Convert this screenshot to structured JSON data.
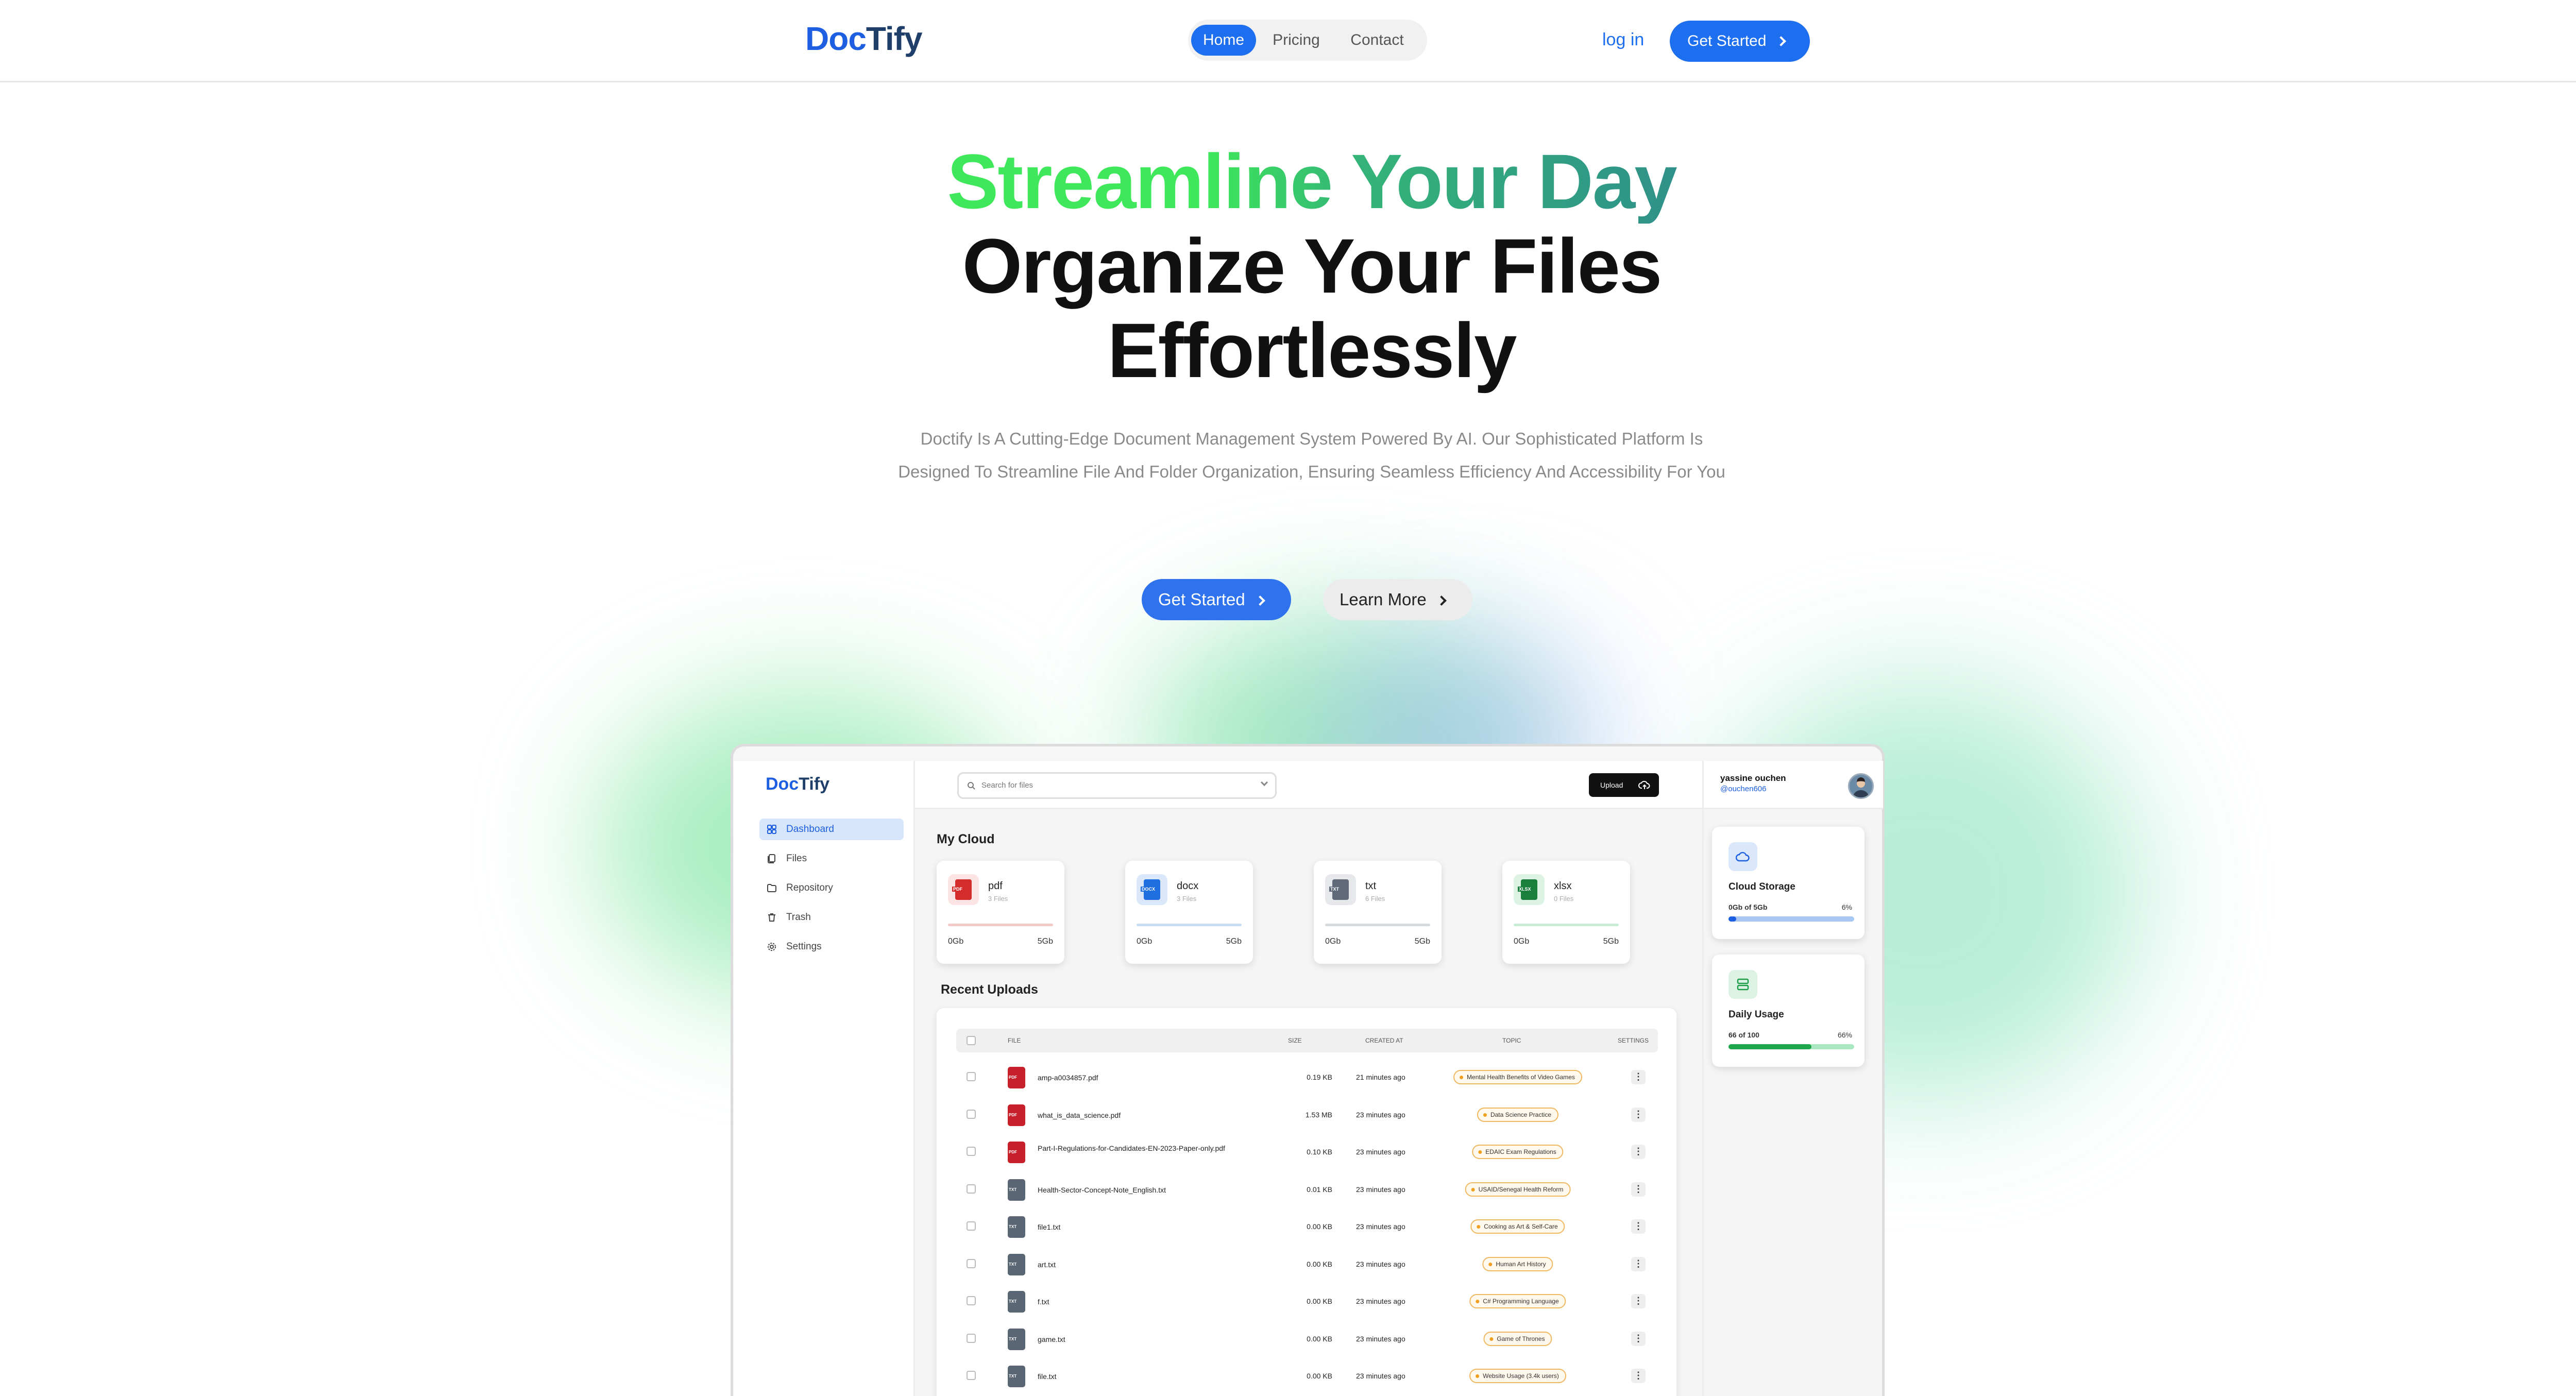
{
  "nav": {
    "logo_a": "Doc",
    "logo_b": "Tify",
    "home": "Home",
    "pricing": "Pricing",
    "contact": "Contact",
    "login": "log in",
    "get_started": "Get Started"
  },
  "hero": {
    "line1": "Streamline Your Day",
    "line2": "Organize Your Files",
    "line3": "Effortlessly",
    "subtitle": "Doctify Is A Cutting-Edge Document Management System Powered By AI. Our Sophisticated Platform Is Designed To Streamline File And Folder Organization, Ensuring Seamless Efficiency And Accessibility For You",
    "cta_primary": "Get Started",
    "cta_secondary": "Learn More"
  },
  "app": {
    "logo_a": "Doc",
    "logo_b": "Tify",
    "sidebar": [
      "Dashboard",
      "Files",
      "Repository",
      "Trash",
      "Settings"
    ],
    "search_placeholder": "Search for files",
    "upload_label": "Upload",
    "my_cloud": "My Cloud",
    "recent_uploads": "Recent Uploads",
    "cards": [
      {
        "name": "pdf",
        "count": "3 Files",
        "low": "0Gb",
        "high": "5Gb",
        "color": "#d42b2b",
        "bg": "#fde4e4",
        "bar": "#f6c9c9",
        "tag": "PDF"
      },
      {
        "name": "docx",
        "count": "3 Files",
        "low": "0Gb",
        "high": "5Gb",
        "color": "#1f6fe0",
        "bg": "#dbe8fb",
        "bar": "#c9dcf6",
        "tag": "DOCX"
      },
      {
        "name": "txt",
        "count": "6 Files",
        "low": "0Gb",
        "high": "5Gb",
        "color": "#606a78",
        "bg": "#e6e8ec",
        "bar": "#d6d9de",
        "tag": "TXT"
      },
      {
        "name": "xlsx",
        "count": "0 Files",
        "low": "0Gb",
        "high": "5Gb",
        "color": "#1a7f3c",
        "bg": "#dcf2e3",
        "bar": "#c9ecd5",
        "tag": "XLSX"
      }
    ],
    "table_headers": {
      "file": "FILE",
      "size": "SIZE",
      "created": "CREATED AT",
      "topic": "TOPIC",
      "settings": "SETTINGS"
    },
    "rows": [
      {
        "type": "pdf",
        "name": "amp-a0034857.pdf",
        "size": "0.19 KB",
        "created": "21 minutes ago",
        "topic": "Mental Health Benefits of Video Games"
      },
      {
        "type": "pdf",
        "name": "what_is_data_science.pdf",
        "size": "1.53 MB",
        "created": "23 minutes ago",
        "topic": "Data Science Practice"
      },
      {
        "type": "pdf",
        "name": "Part-I-Regulations-for-Candidates-EN-2023-Paper-only.pdf",
        "size": "0.10 KB",
        "created": "23 minutes ago",
        "topic": "EDAIC Exam Regulations"
      },
      {
        "type": "txt",
        "name": "Health-Sector-Concept-Note_English.txt",
        "size": "0.01 KB",
        "created": "23 minutes ago",
        "topic": "USAID/Senegal Health Reform"
      },
      {
        "type": "txt",
        "name": "file1.txt",
        "size": "0.00 KB",
        "created": "23 minutes ago",
        "topic": "Cooking as Art & Self-Care"
      },
      {
        "type": "txt",
        "name": "art.txt",
        "size": "0.00 KB",
        "created": "23 minutes ago",
        "topic": "Human Art History"
      },
      {
        "type": "txt",
        "name": "f.txt",
        "size": "0.00 KB",
        "created": "23 minutes ago",
        "topic": "C# Programming Language"
      },
      {
        "type": "txt",
        "name": "game.txt",
        "size": "0.00 KB",
        "created": "23 minutes ago",
        "topic": "Game of Thrones"
      },
      {
        "type": "txt",
        "name": "file.txt",
        "size": "0.00 KB",
        "created": "23 minutes ago",
        "topic": "Website Usage (3.4k users)"
      }
    ],
    "user": {
      "name": "yassine ouchen",
      "handle": "@ouchen606"
    },
    "storage": {
      "title": "Cloud Storage",
      "label": "0Gb of 5Gb",
      "percent_text": "6%",
      "fraction": 0.06
    },
    "usage": {
      "title": "Daily Usage",
      "label": "66 of 100",
      "percent_text": "66%",
      "fraction": 0.66
    }
  },
  "colors": {
    "accent": "#1d6ff0",
    "gradient_start": "#3ee85a",
    "gradient_end": "#2f8f8a"
  }
}
